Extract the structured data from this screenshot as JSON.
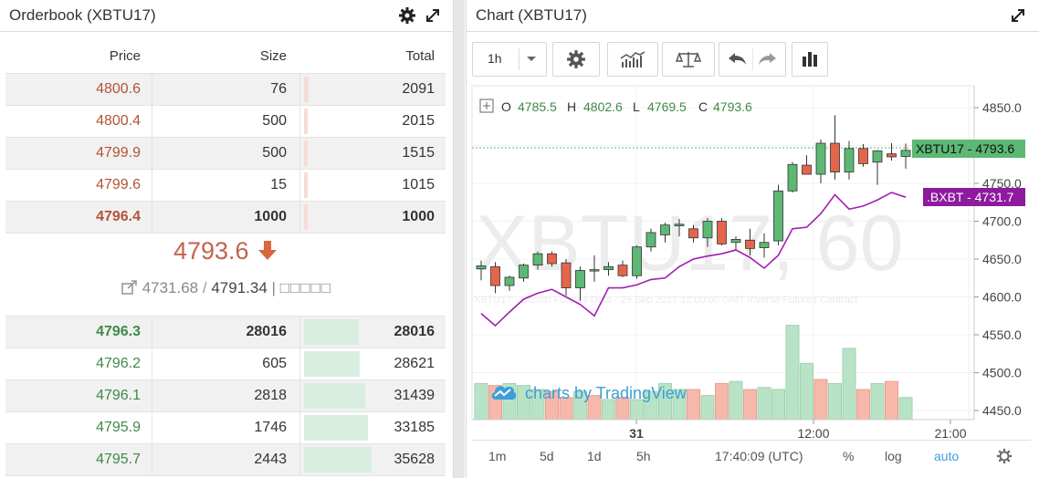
{
  "orderbook": {
    "title": "Orderbook (XBTU17)",
    "headers": {
      "price": "Price",
      "size": "Size",
      "total": "Total"
    },
    "asks": [
      {
        "price": "4800.6",
        "size": "76",
        "total": "2091",
        "depth": 0.04
      },
      {
        "price": "4800.4",
        "size": "500",
        "total": "2015",
        "depth": 0.03
      },
      {
        "price": "4799.9",
        "size": "500",
        "total": "1515",
        "depth": 0.03
      },
      {
        "price": "4799.6",
        "size": "15",
        "total": "1015",
        "depth": 0.02
      },
      {
        "price": "4796.4",
        "size": "1000",
        "total": "1000",
        "depth": 0.02
      }
    ],
    "last_price": "4793.6",
    "index_price": "4731.68",
    "fair_price": "4791.34",
    "separator": "|",
    "boxes": "□□□□□",
    "bids": [
      {
        "price": "4796.3",
        "size": "28016",
        "total": "28016",
        "depth": 0.47
      },
      {
        "price": "4796.2",
        "size": "605",
        "total": "28621",
        "depth": 0.48
      },
      {
        "price": "4796.1",
        "size": "2818",
        "total": "31439",
        "depth": 0.52
      },
      {
        "price": "4795.9",
        "size": "1746",
        "total": "33185",
        "depth": 0.55
      },
      {
        "price": "4795.7",
        "size": "2443",
        "total": "35628",
        "depth": 0.58
      }
    ]
  },
  "chart": {
    "title": "Chart (XBTU17)",
    "interval": "1h",
    "ohlc": {
      "o_label": "O",
      "o": "4785.5",
      "h_label": "H",
      "h": "4802.6",
      "l_label": "L",
      "l": "4769.5",
      "c_label": "C",
      "c": "4793.6"
    },
    "watermark": "XBTU17, 60",
    "subwatermark": "XBTU17 · Bitcoin Futures Data · 29 Sep 2017 12:00:00 GMT Inverse Futures Contract",
    "logo_text": "charts by TradingView",
    "tag_main": "XBTU17 - 4793.6",
    "tag_index": ".BXBT - 4731.7",
    "y_ticks": [
      "4850.0",
      "4800.0",
      "4750.0",
      "4700.0",
      "4650.0",
      "4600.0",
      "4550.0",
      "4500.0",
      "4450.0"
    ],
    "x_ticks": [
      {
        "label": "31",
        "bold": true
      },
      {
        "label": "12:00",
        "bold": false
      },
      {
        "label": "21:00",
        "bold": false
      }
    ],
    "ranges": [
      "1m",
      "5d",
      "1d",
      "5h"
    ],
    "clock": "17:40:09 (UTC)",
    "percent": "%",
    "log": "log",
    "auto": "auto",
    "colors": {
      "up": "#5cb874",
      "down": "#e4664a",
      "index": "#a020b0",
      "tag_main": "#5cb874",
      "tag_index": "#8e1a9e"
    }
  },
  "chart_data": {
    "type": "line",
    "title": "",
    "ylim": [
      4430,
      4865
    ],
    "candles": [
      {
        "o": 4637,
        "h": 4648,
        "l": 4622,
        "c": 4641
      },
      {
        "o": 4640,
        "h": 4646,
        "l": 4605,
        "c": 4615
      },
      {
        "o": 4615,
        "h": 4628,
        "l": 4608,
        "c": 4626
      },
      {
        "o": 4625,
        "h": 4644,
        "l": 4620,
        "c": 4642
      },
      {
        "o": 4642,
        "h": 4660,
        "l": 4636,
        "c": 4657
      },
      {
        "o": 4657,
        "h": 4660,
        "l": 4640,
        "c": 4644
      },
      {
        "o": 4645,
        "h": 4650,
        "l": 4602,
        "c": 4612
      },
      {
        "o": 4612,
        "h": 4640,
        "l": 4595,
        "c": 4635
      },
      {
        "o": 4636,
        "h": 4655,
        "l": 4620,
        "c": 4636
      },
      {
        "o": 4636,
        "h": 4646,
        "l": 4628,
        "c": 4640
      },
      {
        "o": 4642,
        "h": 4648,
        "l": 4626,
        "c": 4628
      },
      {
        "o": 4628,
        "h": 4668,
        "l": 4624,
        "c": 4666
      },
      {
        "o": 4666,
        "h": 4690,
        "l": 4660,
        "c": 4685
      },
      {
        "o": 4682,
        "h": 4698,
        "l": 4672,
        "c": 4695
      },
      {
        "o": 4694,
        "h": 4703,
        "l": 4680,
        "c": 4696
      },
      {
        "o": 4690,
        "h": 4695,
        "l": 4672,
        "c": 4678
      },
      {
        "o": 4678,
        "h": 4704,
        "l": 4666,
        "c": 4700
      },
      {
        "o": 4700,
        "h": 4704,
        "l": 4668,
        "c": 4670
      },
      {
        "o": 4672,
        "h": 4680,
        "l": 4662,
        "c": 4676
      },
      {
        "o": 4675,
        "h": 4690,
        "l": 4655,
        "c": 4664
      },
      {
        "o": 4665,
        "h": 4684,
        "l": 4652,
        "c": 4672
      },
      {
        "o": 4674,
        "h": 4748,
        "l": 4668,
        "c": 4740
      },
      {
        "o": 4740,
        "h": 4778,
        "l": 4738,
        "c": 4775
      },
      {
        "o": 4774,
        "h": 4787,
        "l": 4762,
        "c": 4762
      },
      {
        "o": 4762,
        "h": 4808,
        "l": 4750,
        "c": 4803
      },
      {
        "o": 4803,
        "h": 4840,
        "l": 4755,
        "c": 4765
      },
      {
        "o": 4765,
        "h": 4806,
        "l": 4755,
        "c": 4796
      },
      {
        "o": 4796,
        "h": 4802,
        "l": 4772,
        "c": 4776
      },
      {
        "o": 4778,
        "h": 4794,
        "l": 4748,
        "c": 4793
      },
      {
        "o": 4789,
        "h": 4803,
        "l": 4780,
        "c": 4785
      },
      {
        "o": 4785.5,
        "h": 4802.6,
        "l": 4769.5,
        "c": 4793.6
      }
    ],
    "series": [
      {
        "name": ".BXBT",
        "values": [
          4578,
          4562,
          4580,
          4597,
          4605,
          4610,
          4600,
          4590,
          4575,
          4612,
          4612,
          4616,
          4623,
          4625,
          4640,
          4650,
          4654,
          4657,
          4662,
          4652,
          4638,
          4655,
          4690,
          4692,
          4710,
          4735,
          4716,
          4720,
          4728,
          4738,
          4731.7
        ]
      }
    ],
    "volumes": [
      0.36,
      0.34,
      0.36,
      0.34,
      0.3,
      0.28,
      0.22,
      0.28,
      0.24,
      0.2,
      0.22,
      0.2,
      0.28,
      0.36,
      0.3,
      0.3,
      0.24,
      0.36,
      0.38,
      0.3,
      0.32,
      0.3,
      0.94,
      0.56,
      0.4,
      0.36,
      0.71,
      0.3,
      0.36,
      0.38,
      0.22
    ],
    "volume_up": [
      true,
      false,
      true,
      true,
      true,
      false,
      false,
      true,
      false,
      true,
      false,
      true,
      true,
      true,
      true,
      false,
      true,
      false,
      true,
      false,
      true,
      true,
      true,
      true,
      false,
      true,
      true,
      false,
      true,
      false,
      true
    ]
  }
}
